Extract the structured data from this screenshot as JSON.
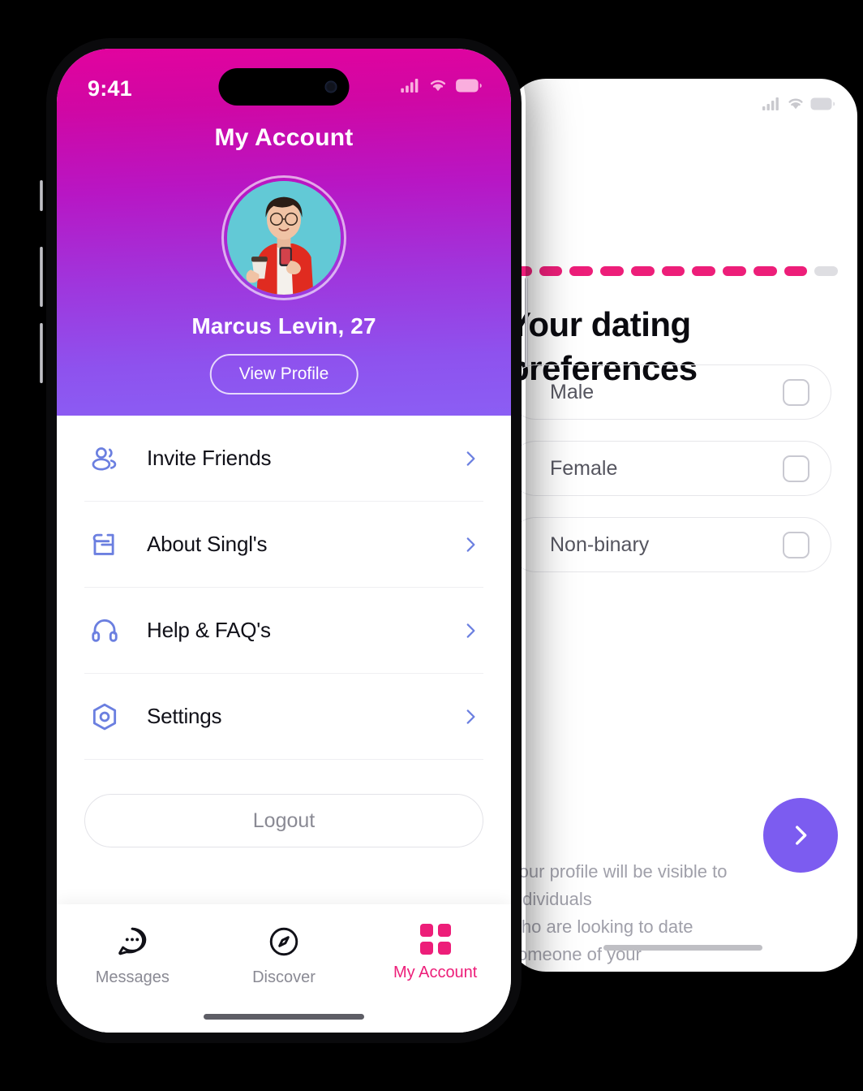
{
  "background_phone": {
    "progress": {
      "total_segments": 11,
      "filled_segments": 10
    },
    "title": "Your dating\npreferences",
    "options": [
      {
        "label": "Male",
        "checked": false
      },
      {
        "label": "Female",
        "checked": false
      },
      {
        "label": "Non-binary",
        "checked": false
      }
    ],
    "footer_note": "Your profile will be visible to individuals\nwho are looking to date someone of your\ngender.",
    "next_button_icon": "chevron-right-icon",
    "status_icons": [
      "cellular-signal-icon",
      "wifi-icon",
      "battery-icon"
    ]
  },
  "foreground_phone": {
    "status_bar": {
      "time": "9:41",
      "icons": [
        "cellular-signal-icon",
        "wifi-icon",
        "battery-icon"
      ]
    },
    "header": {
      "title": "My Account",
      "gradient_start": "#E2039E",
      "gradient_end": "#8B5EF4",
      "profile": {
        "name_age": "Marcus Levin, 27",
        "avatar_name": "user-avatar",
        "view_profile_label": "View Profile"
      }
    },
    "menu": {
      "accent_color": "#6B7FE0",
      "items": [
        {
          "label": "Invite Friends",
          "icon": "people-icon"
        },
        {
          "label": "About Singl's",
          "icon": "singls-logo-icon"
        },
        {
          "label": "Help & FAQ's",
          "icon": "headphones-icon"
        },
        {
          "label": "Settings",
          "icon": "settings-hexagon-icon"
        }
      ]
    },
    "logout_label": "Logout",
    "tabbar": {
      "active_color": "#ED1E79",
      "inactive_color": "#8A8A94",
      "tabs": [
        {
          "label": "Messages",
          "icon": "chat-bubble-icon",
          "active": false
        },
        {
          "label": "Discover",
          "icon": "compass-icon",
          "active": false
        },
        {
          "label": "My Account",
          "icon": "grid-icon",
          "active": true
        }
      ]
    }
  }
}
